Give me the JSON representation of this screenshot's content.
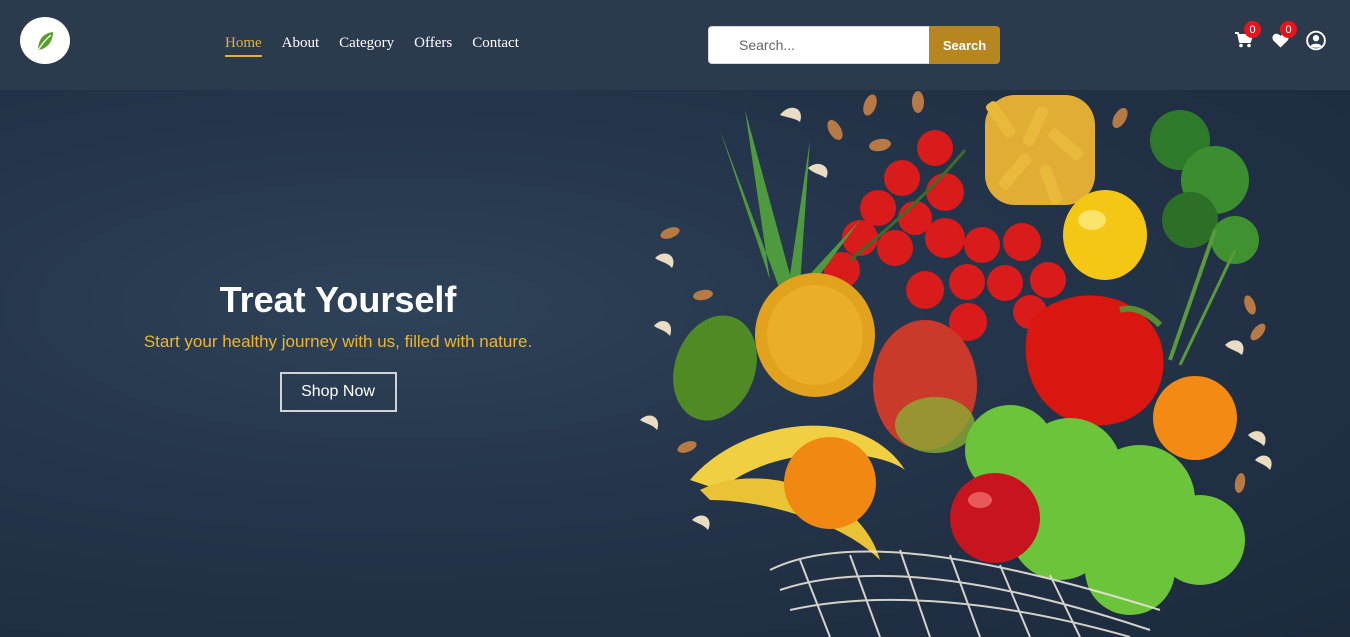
{
  "brand": {
    "logo_icon": "leaf-icon",
    "colors": {
      "nav_bg": "#2c3a4e",
      "accent": "#e2b03b",
      "button": "#b8861f",
      "badge": "#e8141c"
    }
  },
  "nav": {
    "links": [
      {
        "label": "Home",
        "active": true
      },
      {
        "label": "About"
      },
      {
        "label": "Category"
      },
      {
        "label": "Offers"
      },
      {
        "label": "Contact"
      }
    ]
  },
  "search": {
    "placeholder": "Search...",
    "button_label": "Search"
  },
  "icons": {
    "cart": {
      "name": "cart-icon",
      "count": "0"
    },
    "wishlist": {
      "name": "heart-icon",
      "count": "0"
    },
    "account": {
      "name": "user-circle-icon"
    }
  },
  "hero": {
    "title": "Treat Yourself",
    "subtitle": "Start your healthy journey with us, filled with nature.",
    "cta_label": "Shop Now"
  }
}
